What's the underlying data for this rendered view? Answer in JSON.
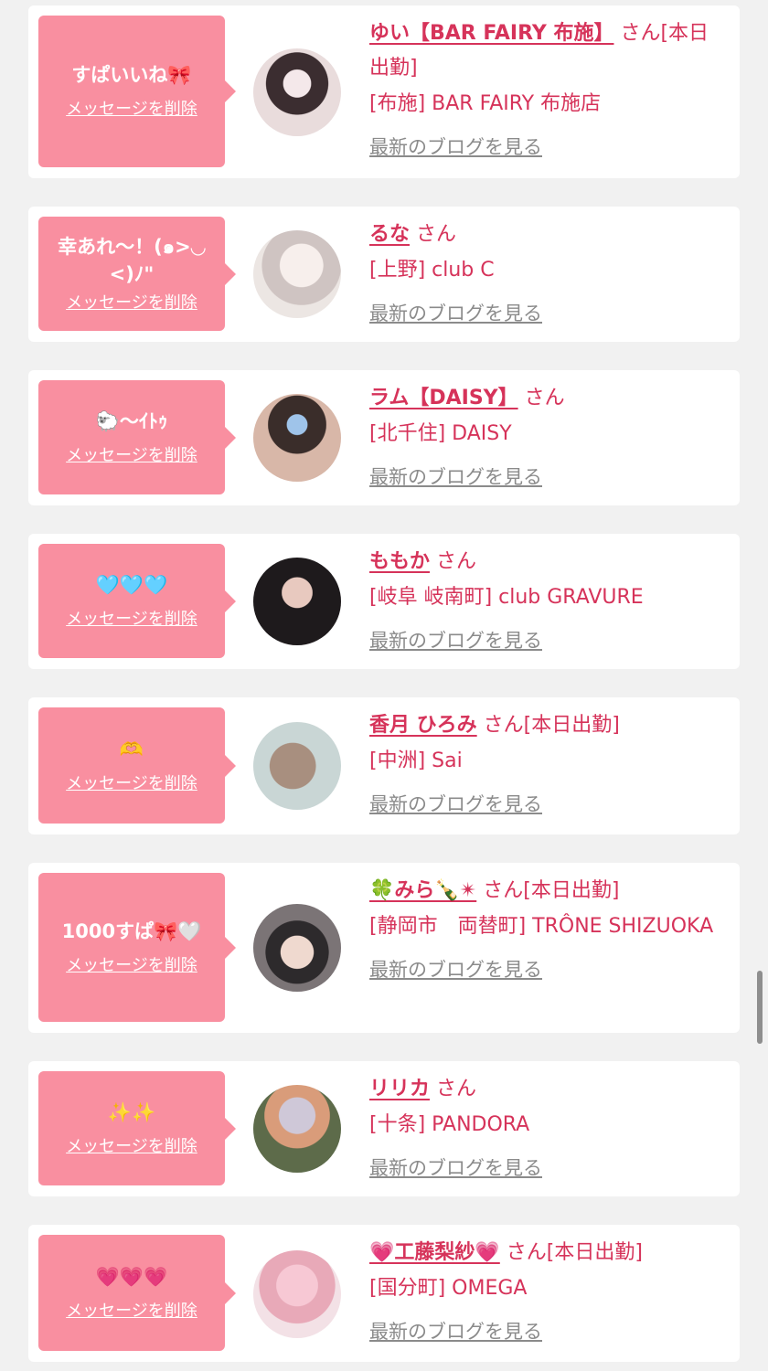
{
  "colors": {
    "background": "#f1f1f1",
    "bubble": "#f98fa0",
    "accent": "#d6335a",
    "link_gray": "#8b8b8b"
  },
  "delete_label": "メッセージを削除",
  "blog_label": "最新のブログを見る",
  "items": [
    {
      "message": "すぱいいね🎀",
      "name": "ゆい【BAR FAIRY 布施】",
      "suffix": "さん[本日出勤]",
      "shop": "[布施] BAR FAIRY 布施店",
      "avatar_icon": "profile-photo"
    },
    {
      "message": "幸あれ〜！(๑>◡<)ﾉ\"",
      "name": "るな",
      "suffix": "さん",
      "shop": "[上野] club C",
      "avatar_icon": "profile-photo"
    },
    {
      "message": "🐑〜ｲﾄｩ",
      "name": "ラム【DAISY】",
      "suffix": "さん",
      "shop": "[北千住] DAISY",
      "avatar_icon": "profile-photo"
    },
    {
      "message": "🩵🩵🩵",
      "name": "ももか",
      "suffix": "さん",
      "shop": "[岐阜 岐南町] club GRAVURE",
      "avatar_icon": "profile-photo"
    },
    {
      "message": "🫶",
      "name": "香月 ひろみ",
      "suffix": "さん[本日出勤]",
      "shop": "[中洲] Sai",
      "avatar_icon": "profile-photo"
    },
    {
      "message": "1000すぱ🎀🤍",
      "name": "🍀みら🍾✴",
      "suffix": "さん[本日出勤]",
      "shop": "[静岡市　両替町] TRÔNE SHIZUOKA",
      "avatar_icon": "profile-photo"
    },
    {
      "message": "✨✨",
      "name": "リリカ",
      "suffix": "さん",
      "shop": "[十条] PANDORA",
      "avatar_icon": "profile-photo"
    },
    {
      "message": "💗💗💗",
      "name": "💗工藤梨紗💗",
      "suffix": "さん[本日出勤]",
      "shop": "[国分町] OMEGA",
      "avatar_icon": "profile-photo"
    }
  ]
}
